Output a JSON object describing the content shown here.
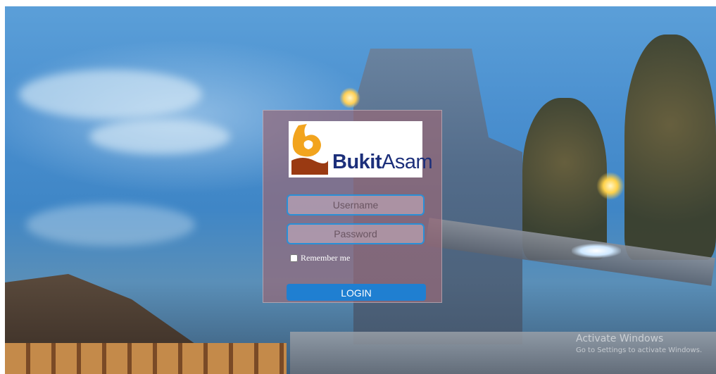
{
  "brand": {
    "logo_name_bold": "Bukit",
    "logo_name_regular": "Asam",
    "logo_colors": {
      "mark_orange": "#f2a41e",
      "mark_brown": "#9a3a12",
      "text_navy": "#1c2f7a"
    }
  },
  "login": {
    "username_placeholder": "Username",
    "password_placeholder": "Password",
    "remember_label": "Remember me",
    "remember_checked": false,
    "login_label": "LOGIN",
    "accent_color": "#1f7fd1"
  },
  "watermark": {
    "title": "Activate Windows",
    "subtitle": "Go to Settings to activate Windows."
  }
}
